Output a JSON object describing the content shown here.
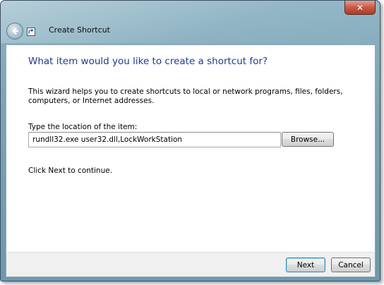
{
  "window": {
    "title": "Create Shortcut",
    "close_label": "✕"
  },
  "content": {
    "heading": "What item would you like to create a shortcut for?",
    "intro": "This wizard helps you to create shortcuts to local or network programs, files, folders, computers, or Internet addresses.",
    "location_label": "Type the location of the item:",
    "location_value": "rundll32.exe user32.dll,LockWorkStation",
    "browse_label": "Browse...",
    "continue_text": "Click Next to continue."
  },
  "footer": {
    "next_label": "Next",
    "cancel_label": "Cancel"
  },
  "icons": {
    "back": "back-arrow-icon",
    "wizard": "shortcut-wizard-icon",
    "close": "close-icon"
  }
}
